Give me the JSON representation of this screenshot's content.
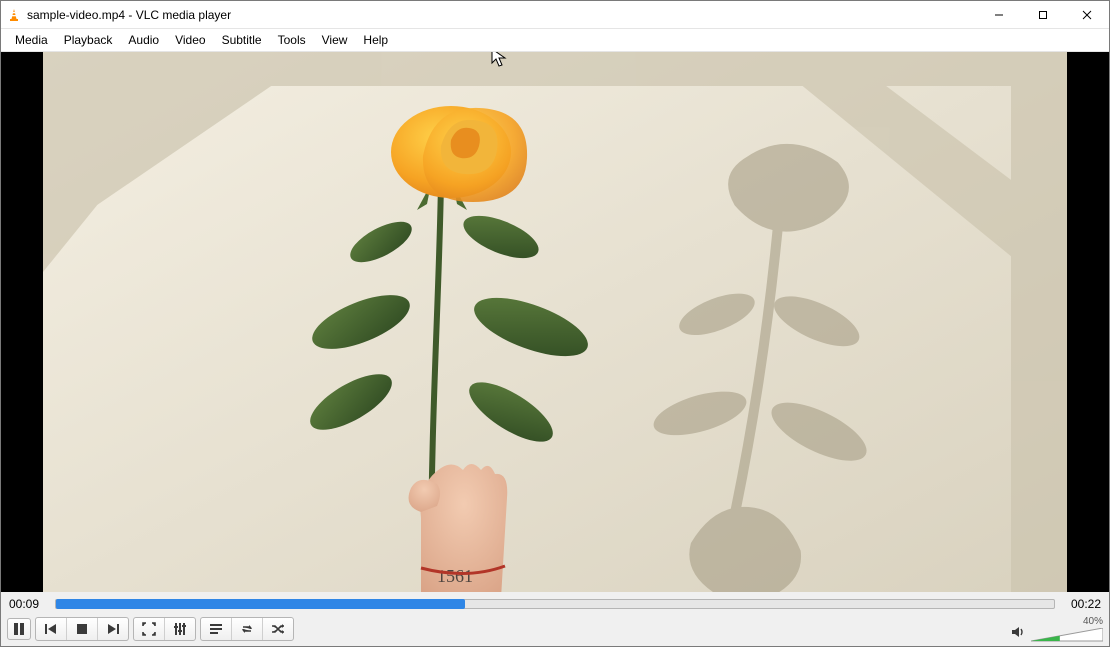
{
  "window": {
    "title": "sample-video.mp4 - VLC media player"
  },
  "menus": {
    "media": "Media",
    "playback": "Playback",
    "audio": "Audio",
    "video": "Video",
    "subtitle": "Subtitle",
    "tools": "Tools",
    "view": "View",
    "help": "Help"
  },
  "playback": {
    "elapsed": "00:09",
    "total": "00:22",
    "progress_percent": 41
  },
  "volume": {
    "percent_label": "40%",
    "level": 40
  }
}
